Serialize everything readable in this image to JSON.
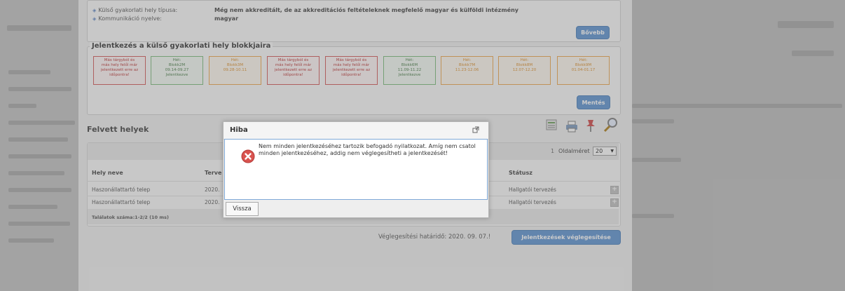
{
  "info": {
    "host_type_label": "Külső gyakorlati hely típusa:",
    "host_type_value": "Még nem akkreditált, de az akkreditációs feltételeknek megfelelő magyar és külföldi intézmény",
    "language_label": "Kommunikáció nyelve:",
    "language_value": "magyar",
    "more_button": "Bővebb"
  },
  "blocks_section": {
    "title": "Jelentkezés a külső gyakorlati hely blokkjaira",
    "save_button": "Mentés",
    "blocks": [
      {
        "line1": "Más tárgyból és",
        "line2": "más hely felől már",
        "line3": "jelentkezett erre az",
        "line4": "időpontra!",
        "status": "red"
      },
      {
        "line1": "Hét:",
        "line2": "Blokk2M",
        "line3": "09.14-09.27",
        "line4": "Jelentkezve",
        "status": "green"
      },
      {
        "line1": "Hét:",
        "line2": "Blokk3M",
        "line3": "09.28-10.11",
        "line4": "",
        "status": "orange"
      },
      {
        "line1": "Más tárgyból és",
        "line2": "más hely felől már",
        "line3": "jelentkezett erre az",
        "line4": "időpontra!",
        "status": "red"
      },
      {
        "line1": "Más tárgyból és",
        "line2": "más hely felől már",
        "line3": "jelentkezett erre az",
        "line4": "időpontra!",
        "status": "red"
      },
      {
        "line1": "Hét:",
        "line2": "Blokk6M",
        "line3": "11.09-11.22",
        "line4": "Jelentkezve",
        "status": "green"
      },
      {
        "line1": "Hét:",
        "line2": "Blokk7M",
        "line3": "11.23-12.06",
        "line4": "",
        "status": "orange"
      },
      {
        "line1": "Hét:",
        "line2": "Blokk8M",
        "line3": "12.07-12.20",
        "line4": "",
        "status": "orange"
      },
      {
        "line1": "Hét:",
        "line2": "Blokk9M",
        "line3": "01.04-01.17",
        "line4": "",
        "status": "orange"
      }
    ]
  },
  "accepted": {
    "title": "Felvett helyek",
    "page_num": "1",
    "page_size_label": "Oldalméret",
    "page_size_value": "20",
    "col_name": "Hely neve",
    "col_term": "Terve",
    "col_status": "Státusz",
    "rows": [
      {
        "name": "Haszonállattartó telep",
        "term": "2020.",
        "status": "Hallgatói tervezés"
      },
      {
        "name": "Haszonállattartó telep",
        "term": "2020.",
        "status": "Hallgatói tervezés"
      }
    ],
    "results": "Találatok száma:1-2/2 (10 ms)",
    "deadline": "Véglegesítési határidő: 2020. 09. 07.!",
    "finalize_button": "Jelentkezések véglegesítése"
  },
  "dialog": {
    "title": "Hiba",
    "message": "Nem minden jelentkezéséhez tartozik befogadó nyilatkozat. Amíg nem csatol minden jelentkezéséhez, addig nem véglegesítheti a jelentkezését!",
    "back_button": "Vissza"
  },
  "colors": {
    "accent": "#6e9fd6",
    "error": "#d9534f",
    "block_red": "#d96a6a",
    "block_green": "#8ac48a",
    "block_orange": "#f0b060"
  }
}
